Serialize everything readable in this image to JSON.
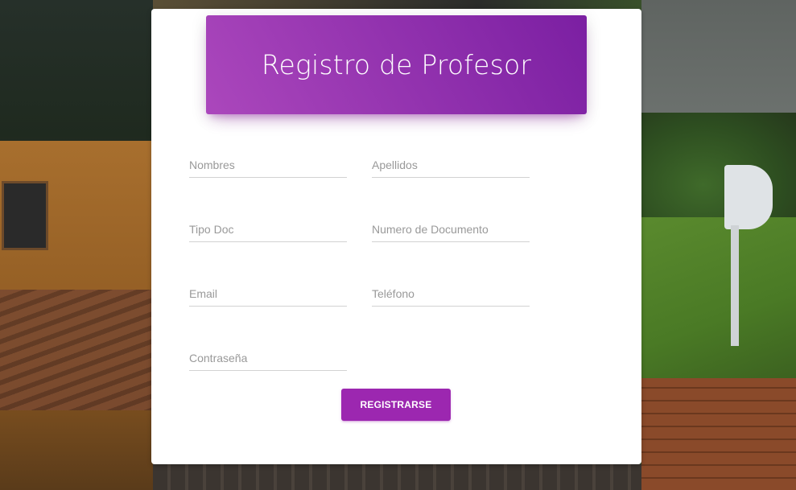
{
  "header": {
    "title": "Registro de Profesor"
  },
  "form": {
    "fields": {
      "nombres": {
        "value": "",
        "placeholder": "Nombres"
      },
      "apellidos": {
        "value": "",
        "placeholder": "Apellidos"
      },
      "tipo_doc": {
        "value": "",
        "placeholder": "Tipo Doc"
      },
      "numero_documento": {
        "value": "",
        "placeholder": "Numero de Documento"
      },
      "email": {
        "value": "",
        "placeholder": "Email"
      },
      "telefono": {
        "value": "",
        "placeholder": "Teléfono"
      },
      "contrasena": {
        "value": "",
        "placeholder": "Contraseña"
      }
    },
    "submit_label": "REGISTRARSE"
  },
  "colors": {
    "accent": "#9c27b0",
    "header_gradient_start": "#ab47bc",
    "header_gradient_end": "#7b1fa2",
    "card_background": "#ffffff",
    "field_underline": "#d2d2d2",
    "placeholder": "#999999"
  }
}
